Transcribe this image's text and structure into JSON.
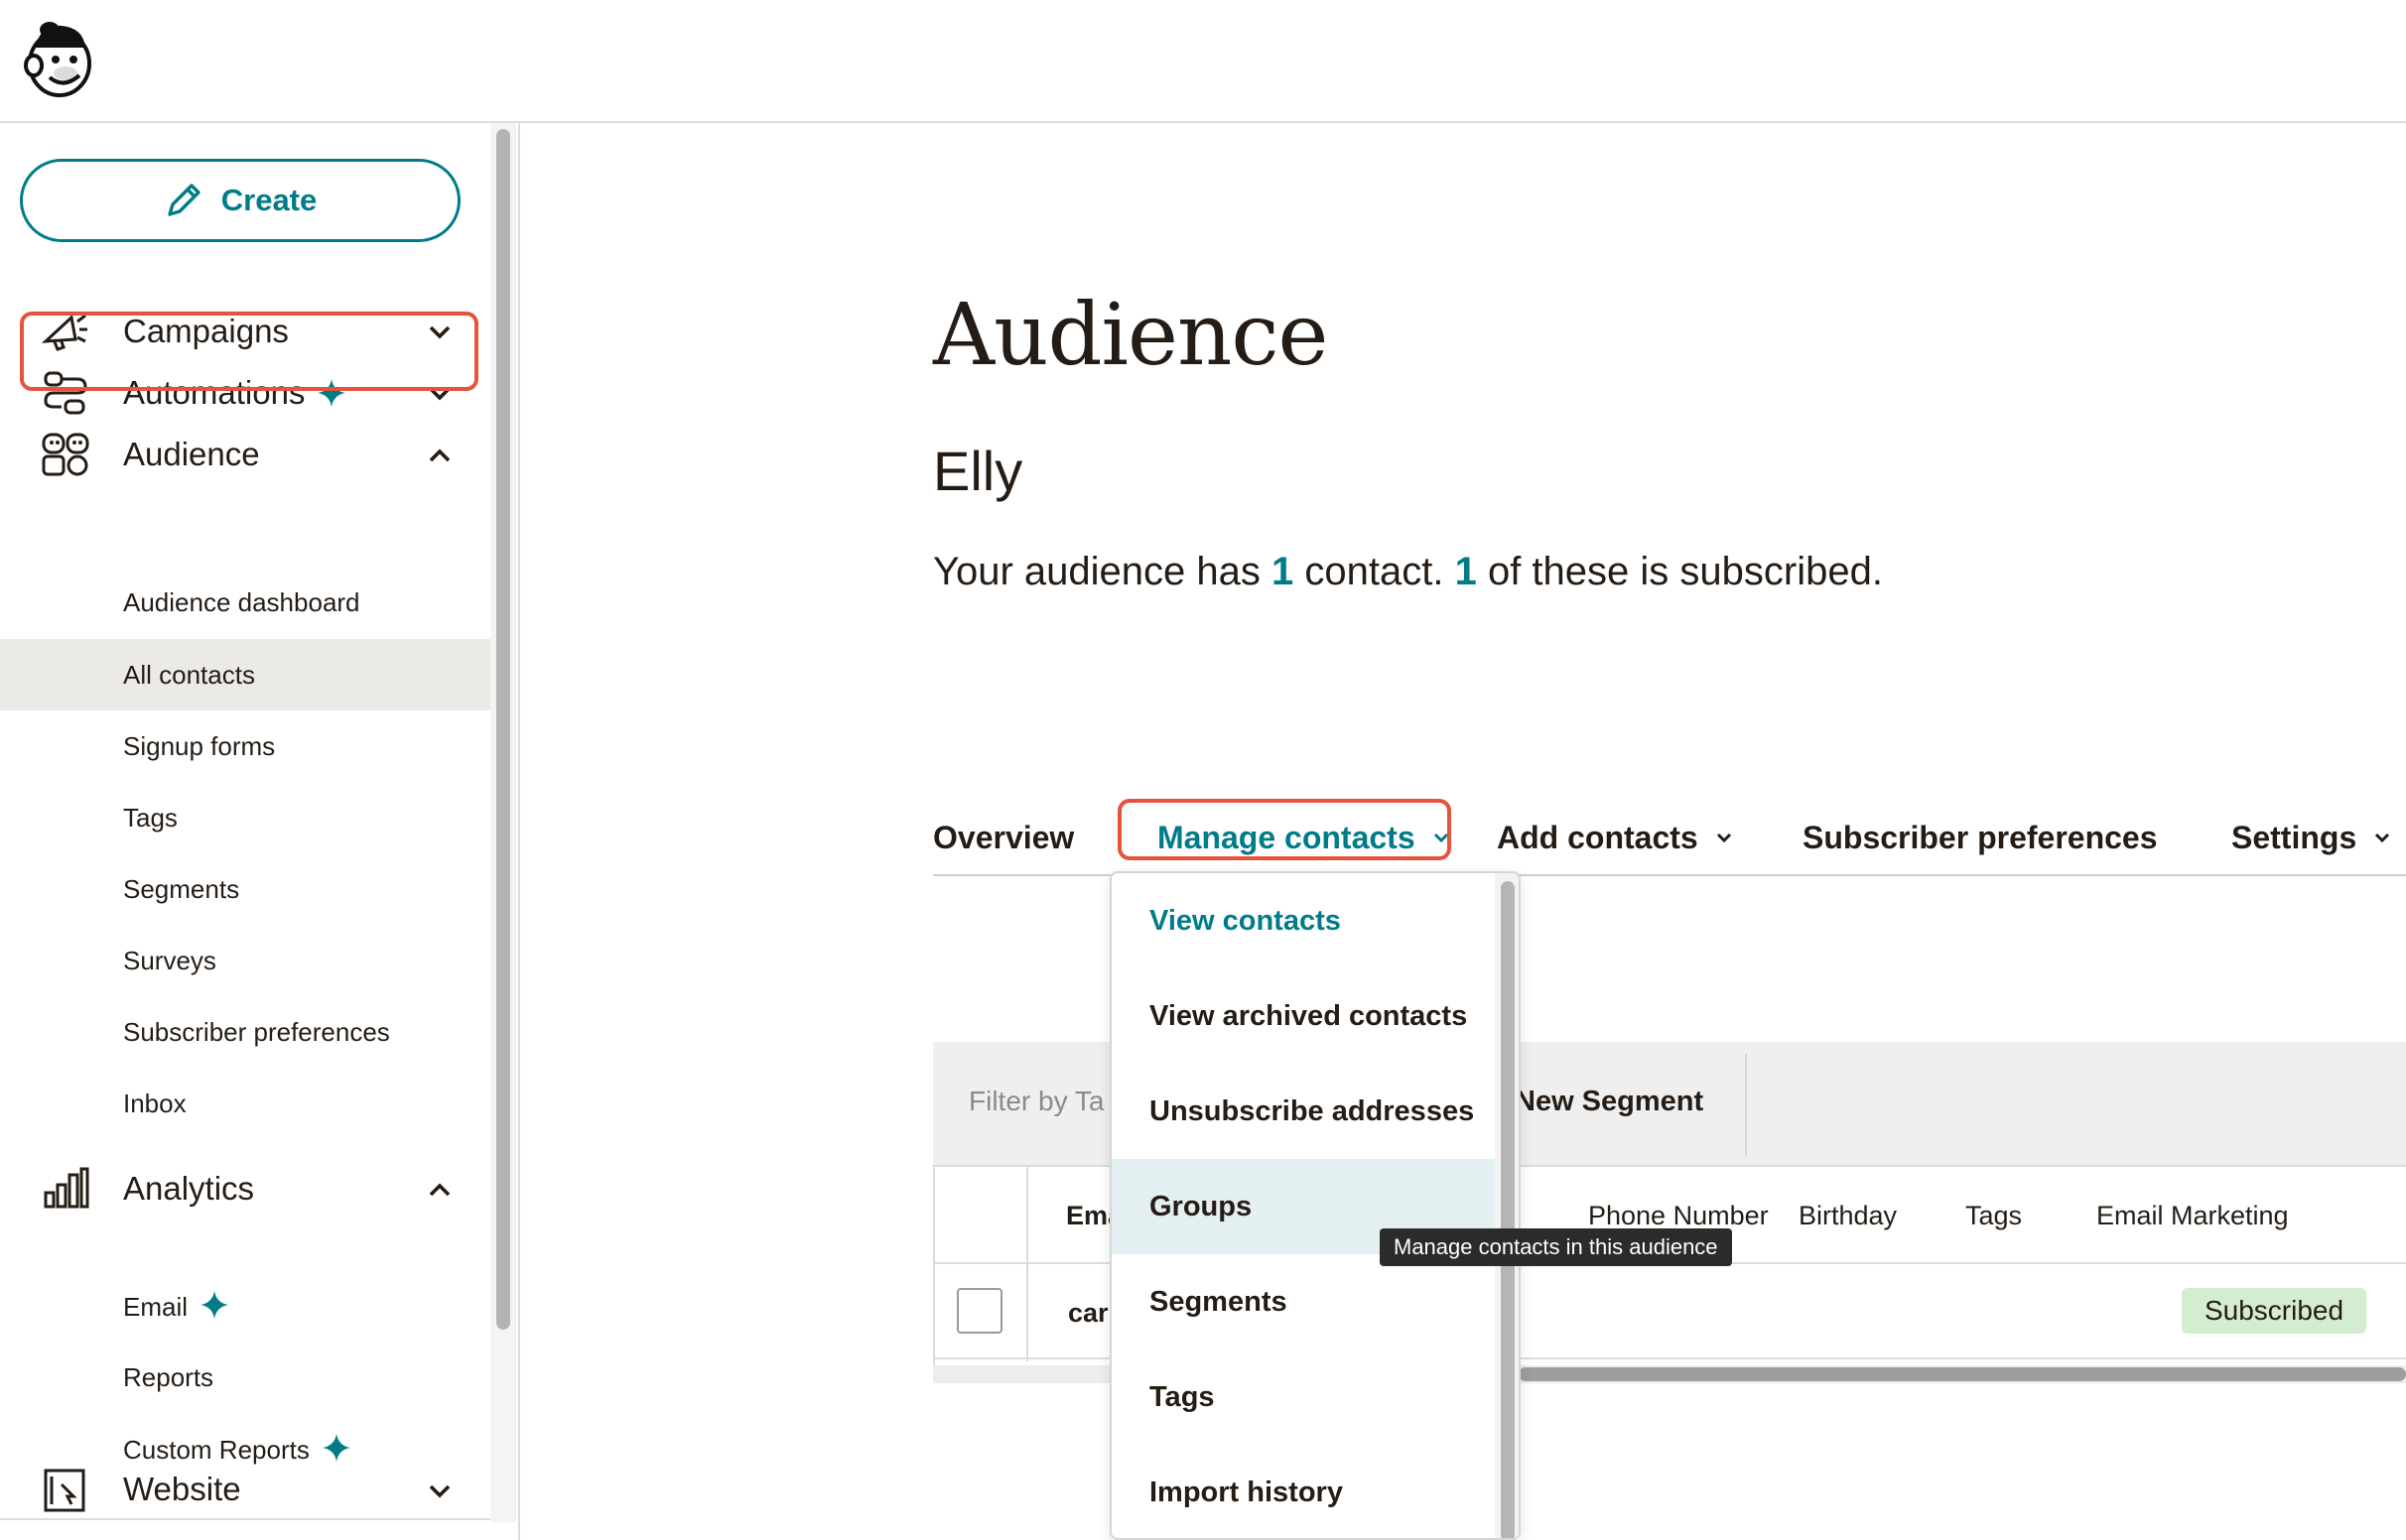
{
  "header": {
    "logo": "mailchimp-freddie-logo"
  },
  "sidebar": {
    "create_label": "Create",
    "nav": [
      {
        "label": "Campaigns",
        "icon": "megaphone-icon",
        "expanded": false,
        "new": false
      },
      {
        "label": "Automations",
        "icon": "automation-flow-icon",
        "expanded": false,
        "new": true
      },
      {
        "label": "Audience",
        "icon": "audience-icon",
        "expanded": true,
        "new": false
      },
      {
        "label": "Analytics",
        "icon": "bar-chart-icon",
        "expanded": true,
        "new": false
      },
      {
        "label": "Website",
        "icon": "website-icon",
        "expanded": false,
        "new": false
      }
    ],
    "audience_items": [
      {
        "label": "Audience dashboard"
      },
      {
        "label": "All contacts",
        "selected": true
      },
      {
        "label": "Signup forms"
      },
      {
        "label": "Tags"
      },
      {
        "label": "Segments"
      },
      {
        "label": "Surveys"
      },
      {
        "label": "Subscriber preferences"
      },
      {
        "label": "Inbox"
      }
    ],
    "analytics_items": [
      {
        "label": "Email",
        "new": true
      },
      {
        "label": "Reports",
        "new": false
      },
      {
        "label": "Custom Reports",
        "new": true
      }
    ]
  },
  "main": {
    "title": "Audience",
    "audience_name": "Elly",
    "summary": {
      "prefix": "Your audience has ",
      "contacts": "1",
      "middle": " contact. ",
      "subscribed": "1",
      "suffix": " of these is subscribed."
    },
    "tabs": [
      {
        "label": "Overview",
        "dropdown": false
      },
      {
        "label": "Manage contacts",
        "dropdown": true,
        "active": true
      },
      {
        "label": "Add contacts",
        "dropdown": true
      },
      {
        "label": "Subscriber preferences",
        "dropdown": false
      },
      {
        "label": "Settings",
        "dropdown": true
      }
    ],
    "filter_placeholder": "Filter by Ta",
    "new_segment": "New Segment",
    "columns": [
      "Ema",
      "Phone Number",
      "Birthday",
      "Tags",
      "Email Marketing"
    ],
    "rows": [
      {
        "email": "carı",
        "status": "Subscribed"
      }
    ]
  },
  "dropdown": {
    "items": [
      {
        "label": "View contacts",
        "active": true
      },
      {
        "label": "View archived contacts"
      },
      {
        "label": "Unsubscribe addresses"
      },
      {
        "label": "Groups",
        "hover": true
      },
      {
        "label": "Segments"
      },
      {
        "label": "Tags"
      },
      {
        "label": "Import history"
      }
    ]
  },
  "tooltip": "Manage contacts in this audience",
  "colors": {
    "accent": "#007c89",
    "highlight": "#e5533c",
    "badge": "#d4eccf",
    "selected_bg": "#ebeae6"
  }
}
